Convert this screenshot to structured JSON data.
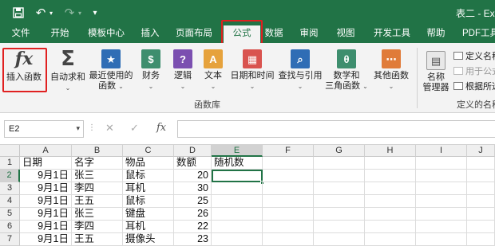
{
  "titlebar": {
    "title": "表二 - Ex",
    "icons": [
      "save-icon",
      "undo-icon",
      "undo-dropdown-icon",
      "redo-icon",
      "customize-qat-icon"
    ]
  },
  "tabs": [
    "文件",
    "开始",
    "模板中心",
    "插入",
    "页面布局",
    "公式",
    "数据",
    "审阅",
    "视图",
    "开发工具",
    "帮助",
    "PDF工具"
  ],
  "active_tab": "公式",
  "ribbon": {
    "insert_function": "插入函数",
    "autosum": "自动求和",
    "recent_line1": "最近使用的",
    "recent_line2": "函数",
    "financial": "财务",
    "logical": "逻辑",
    "text": "文本",
    "datetime": "日期和时间",
    "lookup": "查找与引用",
    "math_line1": "数学和",
    "math_line2": "三角函数",
    "other": "其他函数",
    "group_function_library": "函数库",
    "name_manager_line1": "名称",
    "name_manager_line2": "管理器",
    "define_name": "定义名称",
    "use_in_formula": "用于公式",
    "create_from_selection": "根据所选",
    "group_defined_names": "定义的名称",
    "colors": {
      "accent": "#217346",
      "highlight": "#e02020"
    }
  },
  "formula_bar": {
    "name_box": "E2",
    "cancel": "✕",
    "enter": "✓",
    "fx": "fx",
    "value": ""
  },
  "grid": {
    "columns": [
      "A",
      "B",
      "C",
      "D",
      "E",
      "F",
      "G",
      "H",
      "I",
      "J"
    ],
    "row_numbers": [
      "1",
      "2",
      "3",
      "4",
      "5",
      "6",
      "7"
    ],
    "headers": [
      "日期",
      "名字",
      "物品",
      "数额",
      "随机数"
    ],
    "rows": [
      [
        "9月1日",
        "张三",
        "鼠标",
        "20",
        ""
      ],
      [
        "9月1日",
        "李四",
        "耳机",
        "30",
        ""
      ],
      [
        "9月1日",
        "王五",
        "鼠标",
        "25",
        ""
      ],
      [
        "9月1日",
        "张三",
        "键盘",
        "26",
        ""
      ],
      [
        "9月1日",
        "李四",
        "耳机",
        "22",
        ""
      ],
      [
        "9月1日",
        "王五",
        "摄像头",
        "23",
        ""
      ]
    ],
    "active_cell": "E2"
  }
}
